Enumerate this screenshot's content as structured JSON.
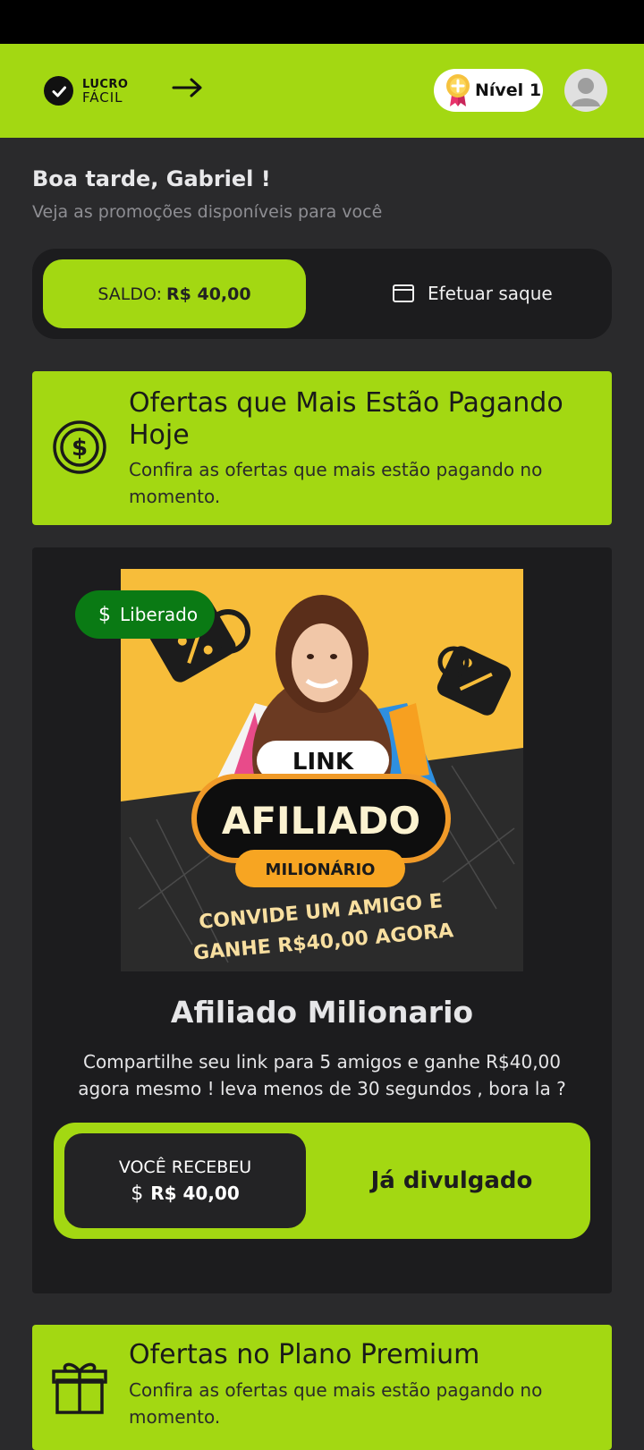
{
  "header": {
    "logo_line1": "LUCRO",
    "logo_line2": "FÁCIL",
    "level_label": "Nível 1"
  },
  "greeting": {
    "title": "Boa tarde, Gabriel !",
    "subtitle": "Veja as promoções disponíveis para você"
  },
  "balance": {
    "label": "SALDO:",
    "value": "R$ 40,00",
    "withdraw_label": "Efetuar saque"
  },
  "banner_top": {
    "icon": "dollar-circle-icon",
    "title": "Ofertas que Mais Estão Pagando Hoje",
    "description": "Confira as ofertas que mais estão pagando no momento."
  },
  "offer": {
    "badge_label": "Liberado",
    "image": {
      "link_text": "LINK",
      "afiliado_text": "AFILIADO",
      "milionario_text": "MILIONÁRIO",
      "line1": "CONVIDE UM AMIGO E",
      "line2": "GANHE R$40,00 AGORA"
    },
    "title": "Afiliado Milionario",
    "description": "Compartilhe seu link para 5 amigos e ganhe R$40,00 agora mesmo ! leva menos de 30 segundos , bora la ?",
    "received_label": "VOCÊ RECEBEU",
    "received_value": "R$ 40,00",
    "status_button": "Já divulgado"
  },
  "banner_premium": {
    "icon": "gift-icon",
    "title": "Ofertas no Plano Premium",
    "description": "Confira as ofertas que mais estão pagando no momento."
  },
  "colors": {
    "accent": "#a3d812",
    "background": "#2a2a2c",
    "card": "#1c1c1e",
    "badge_green": "#0a7a14"
  }
}
